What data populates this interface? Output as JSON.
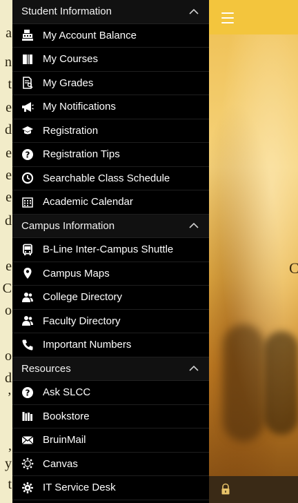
{
  "sections": [
    {
      "title": "Student Information",
      "items": [
        {
          "label": "My Account Balance",
          "icon": "cash-register-icon"
        },
        {
          "label": "My Courses",
          "icon": "book-icon"
        },
        {
          "label": "My Grades",
          "icon": "grades-document-icon"
        },
        {
          "label": "My Notifications",
          "icon": "megaphone-icon"
        },
        {
          "label": "Registration",
          "icon": "graduation-cap-icon"
        },
        {
          "label": "Registration Tips",
          "icon": "question-circle-icon"
        },
        {
          "label": "Searchable Class Schedule",
          "icon": "clock-icon"
        },
        {
          "label": "Academic Calendar",
          "icon": "calendar-icon"
        }
      ]
    },
    {
      "title": "Campus Information",
      "items": [
        {
          "label": "B-Line Inter-Campus Shuttle",
          "icon": "bus-icon"
        },
        {
          "label": "Campus Maps",
          "icon": "map-pin-icon"
        },
        {
          "label": "College Directory",
          "icon": "users-icon"
        },
        {
          "label": "Faculty Directory",
          "icon": "users-icon"
        },
        {
          "label": "Important Numbers",
          "icon": "phone-icon"
        }
      ]
    },
    {
      "title": "Resources",
      "items": [
        {
          "label": "Ask SLCC",
          "icon": "question-circle-icon"
        },
        {
          "label": "Bookstore",
          "icon": "books-icon"
        },
        {
          "label": "BruinMail",
          "icon": "envelope-icon"
        },
        {
          "label": "Canvas",
          "icon": "canvas-logo-icon"
        },
        {
          "label": "IT Service Desk",
          "icon": "wrench-gear-icon"
        }
      ]
    }
  ],
  "left_strip": {
    "chars": [
      "a",
      "n",
      "t",
      "e",
      "d",
      "e",
      "e",
      "e",
      "d",
      "",
      "e",
      "C",
      "o",
      "",
      "o",
      "d",
      "’",
      "",
      ",",
      "y",
      "t"
    ]
  },
  "content": {
    "peek_letter": "C"
  },
  "colors": {
    "drawer_bg": "#000000",
    "header_bg": "#111111",
    "topbar": "#f3c53d",
    "bottombar": "#3a2a16"
  }
}
